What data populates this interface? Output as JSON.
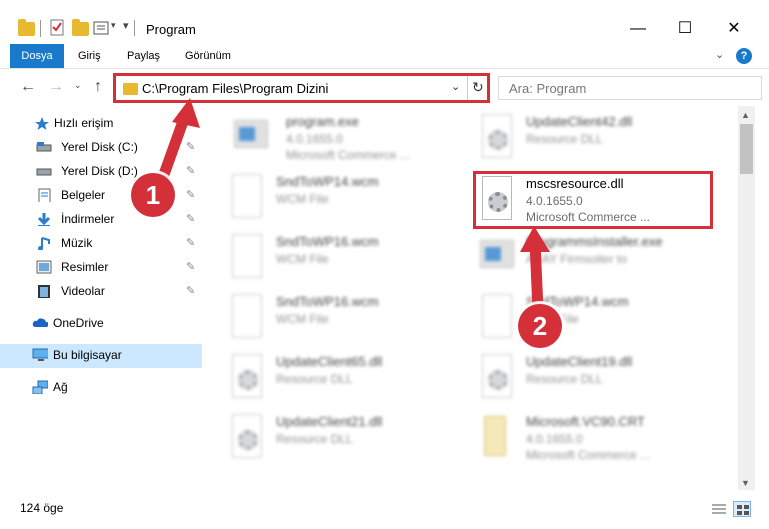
{
  "window": {
    "title": "Program",
    "minimize": "—",
    "maximize": "☐",
    "close": "✕"
  },
  "ribbon": {
    "tabs": [
      "Dosya",
      "Giriş",
      "Paylaş",
      "Görünüm"
    ],
    "help": "?",
    "expand": "⌄"
  },
  "address": {
    "path": "C:\\Program Files\\Program Dizini",
    "dropdown": "⌄",
    "refresh": "↻"
  },
  "search": {
    "placeholder": "Ara: Program"
  },
  "sidebar": {
    "items": [
      {
        "label": "Hızlı erişim",
        "icon": "star-icon"
      },
      {
        "label": "Yerel Disk (C:)",
        "icon": "drive-icon"
      },
      {
        "label": "Yerel Disk (D:)",
        "icon": "drive-icon"
      },
      {
        "label": "Belgeler",
        "icon": "document-icon"
      },
      {
        "label": "İndirmeler",
        "icon": "download-icon"
      },
      {
        "label": "Müzik",
        "icon": "music-icon"
      },
      {
        "label": "Resimler",
        "icon": "pictures-icon"
      },
      {
        "label": "Videolar",
        "icon": "video-icon"
      },
      {
        "label": "OneDrive",
        "icon": "cloud-icon"
      },
      {
        "label": "Bu bilgisayar",
        "icon": "computer-icon"
      },
      {
        "label": "Ağ",
        "icon": "network-icon"
      }
    ],
    "pin": "📌"
  },
  "files": [
    {
      "name": "program.exe",
      "version": "4.0.1655.0",
      "type": "Microsoft Commerce ..."
    },
    {
      "name": "UpdateClient42.dll",
      "version": "",
      "type": "Resource DLL"
    },
    {
      "name": "SndToWP14.wcm",
      "version": "",
      "type": "WCM File"
    },
    {
      "name": "mscsresource.dll",
      "version": "4.0.1655.0",
      "type": "Microsoft Commerce ..."
    },
    {
      "name": "SndToWP16.wcm",
      "version": "",
      "type": "WCM File"
    },
    {
      "name": "ProgrammsInstaller.exe",
      "version": "",
      "type": "ASAY Firmsoiter to"
    },
    {
      "name": "SndToWP16.wcm",
      "version": "",
      "type": "WCM File"
    },
    {
      "name": "SndToWP14.wcm",
      "version": "",
      "type": "WCM File"
    },
    {
      "name": "UpdateClient65.dll",
      "version": "",
      "type": "Resource DLL"
    },
    {
      "name": "UpdateClient19.dll",
      "version": "",
      "type": "Resource DLL"
    },
    {
      "name": "UpdateClient21.dll",
      "version": "",
      "type": "Resource DLL"
    },
    {
      "name": "Microsoft.VC90.CRT",
      "version": "4.0.1655.0",
      "type": "Microsoft Commerce ..."
    }
  ],
  "status": {
    "count": "124 öge"
  },
  "callouts": [
    "1",
    "2"
  ],
  "colors": {
    "accent": "#1979ca",
    "annotation": "#d3303a",
    "selection": "#cce8ff"
  }
}
